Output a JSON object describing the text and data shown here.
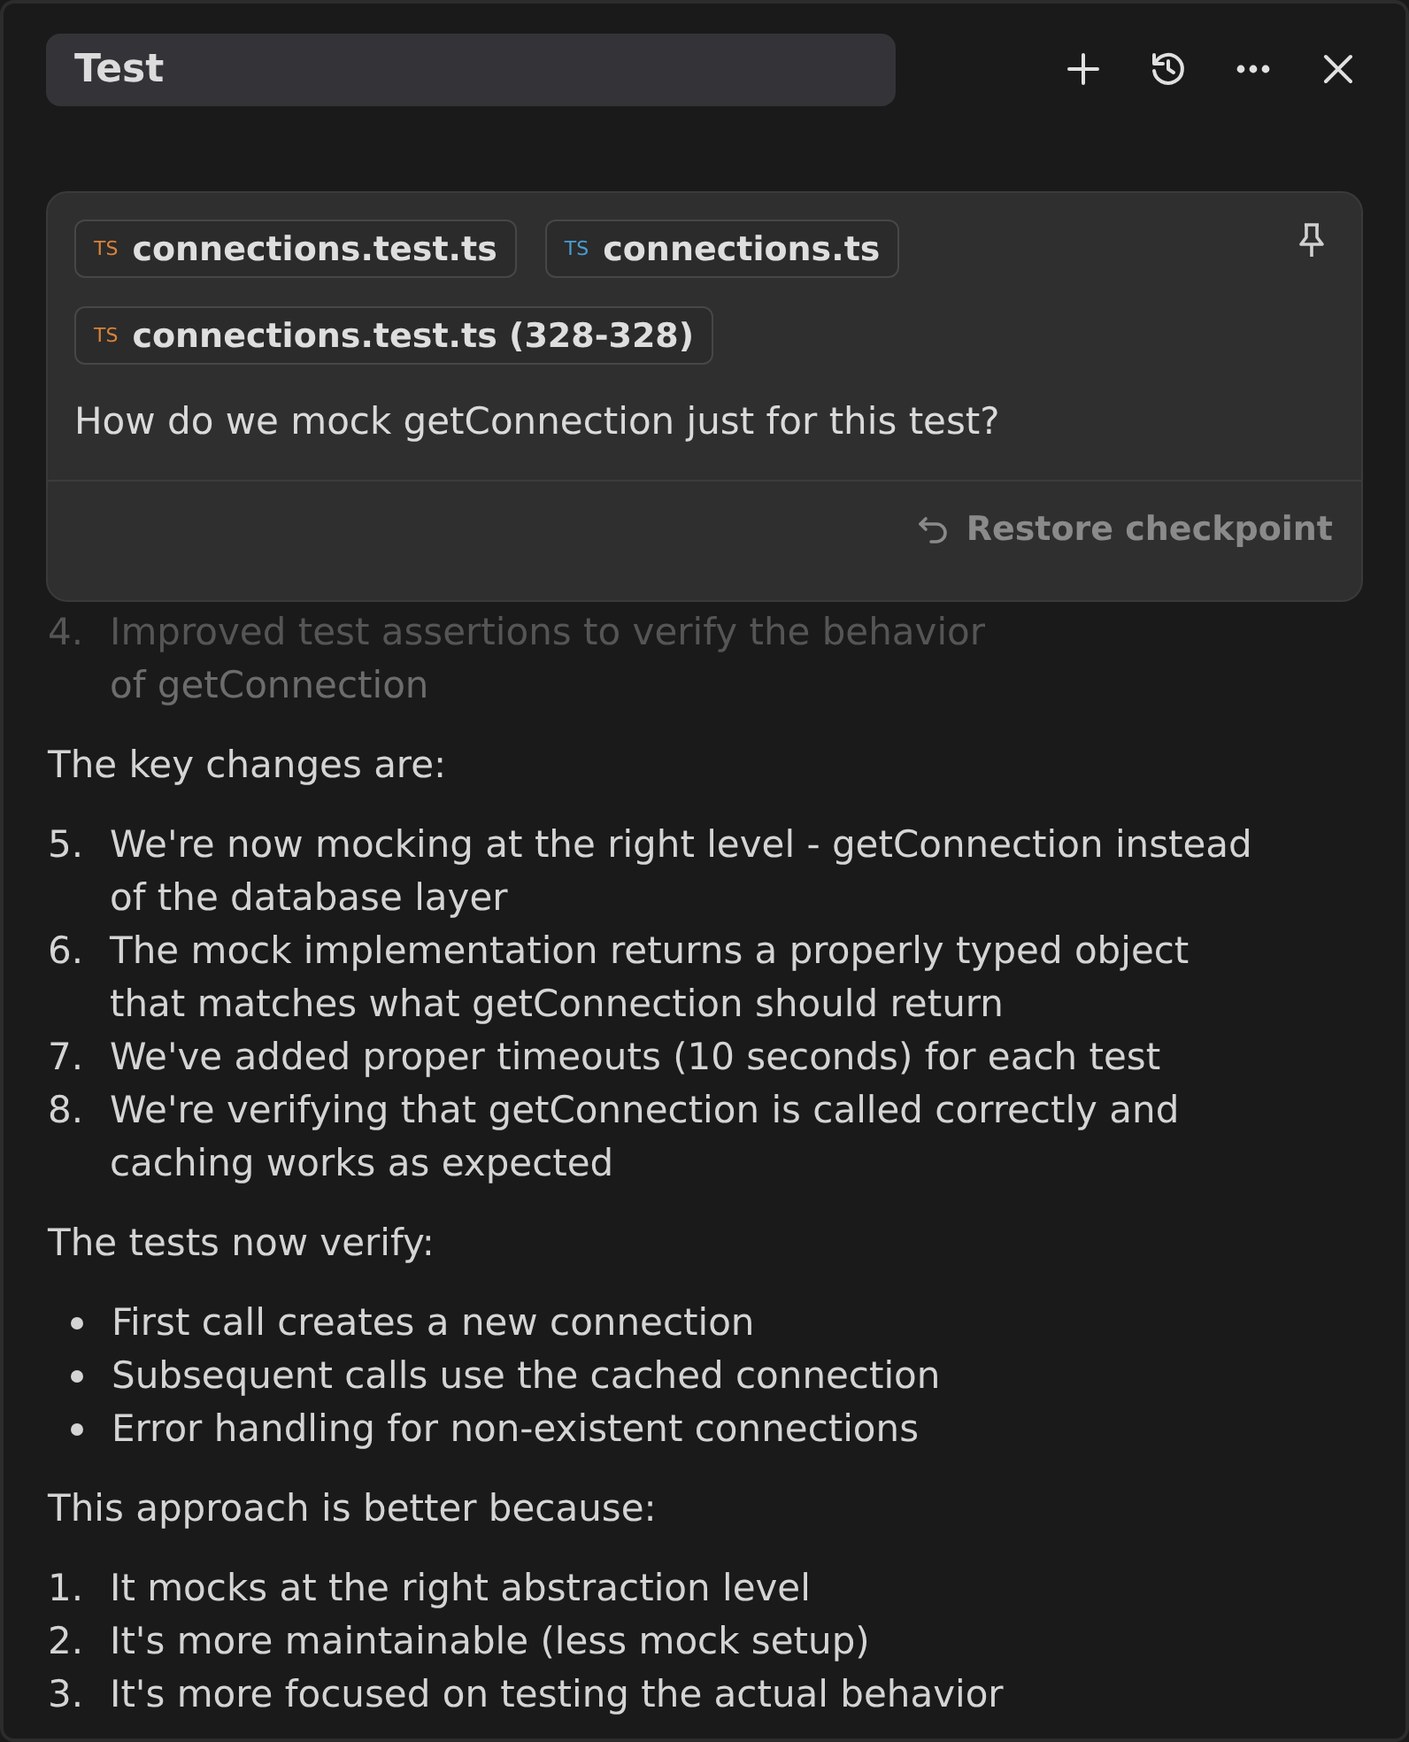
{
  "header": {
    "title": "Test",
    "buttons": [
      {
        "kind": "plus"
      },
      {
        "kind": "history"
      },
      {
        "kind": "more"
      },
      {
        "kind": "close"
      }
    ]
  },
  "message": {
    "chips": [
      {
        "badge": "TS",
        "label": "connections.test.ts",
        "color": "#d9823b"
      },
      {
        "badge": "TS",
        "label": "connections.ts",
        "color": "#4b9bd2"
      },
      {
        "badge": "TS",
        "label": "connections.test.ts (328-328)",
        "color": "#d9823b"
      }
    ],
    "text": "How do we mock getConnection just for this test?",
    "restore": "Restore checkpoint"
  },
  "blocks": [
    {
      "kind": "ordered",
      "faded": true,
      "items": [
        {
          "number": "4.",
          "lines": [
            "Improved test assertions to verify the behavior",
            "of getConnection"
          ]
        }
      ]
    },
    {
      "kind": "paragraph",
      "text": "The key changes are:"
    },
    {
      "kind": "ordered",
      "faded": false,
      "items": [
        {
          "number": "5.",
          "lines": [
            "We're now mocking at the right level - getConnection instead",
            "of the database layer"
          ]
        },
        {
          "number": "6.",
          "lines": [
            "The mock implementation returns a properly typed object",
            "that matches what getConnection should return"
          ]
        },
        {
          "number": "7.",
          "lines": [
            "We've added proper timeouts (10 seconds) for each test"
          ]
        },
        {
          "number": "8.",
          "lines": [
            "We're verifying that getConnection is called correctly and",
            "caching works as expected"
          ]
        }
      ]
    },
    {
      "kind": "paragraph",
      "text": "The tests now verify:"
    },
    {
      "kind": "bullets",
      "items": [
        "First call creates a new connection",
        "Subsequent calls use the cached connection",
        "Error handling for non-existent connections"
      ]
    },
    {
      "kind": "paragraph",
      "text": "This approach is better because:"
    },
    {
      "kind": "ordered",
      "faded": false,
      "items": [
        {
          "number": "1.",
          "lines": [
            "It mocks at the right abstraction level"
          ]
        },
        {
          "number": "2.",
          "lines": [
            "It's more maintainable (less mock setup)"
          ]
        },
        {
          "number": "3.",
          "lines": [
            "It's more focused on testing the actual behavior"
          ]
        }
      ]
    }
  ]
}
